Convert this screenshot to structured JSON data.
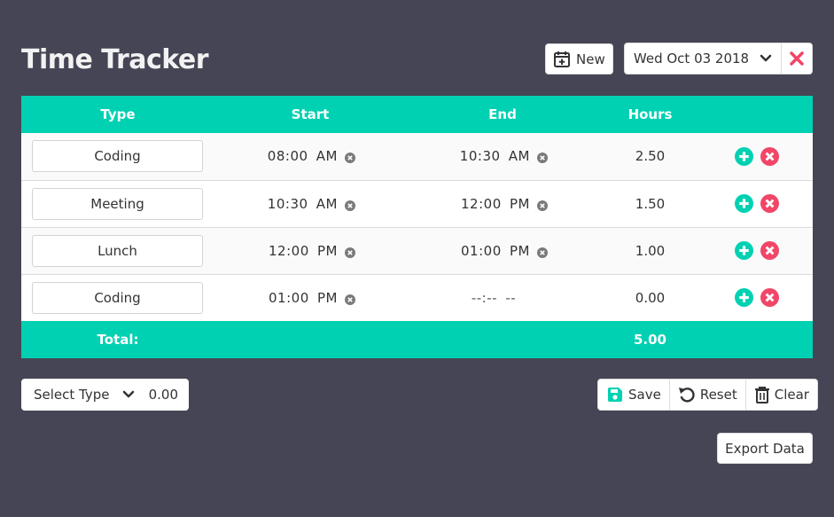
{
  "header": {
    "title": "Time Tracker",
    "new_label": "New",
    "date_value": "Wed Oct 03 2018"
  },
  "table": {
    "columns": [
      "Type",
      "Start",
      "End",
      "Hours"
    ],
    "rows": [
      {
        "type": "Coding",
        "start": "08:00 AM",
        "end": "10:30 AM",
        "hours": "2.50"
      },
      {
        "type": "Meeting",
        "start": "10:30 AM",
        "end": "12:00 PM",
        "hours": "1.50"
      },
      {
        "type": "Lunch",
        "start": "12:00 PM",
        "end": "01:00 PM",
        "hours": "1.00"
      },
      {
        "type": "Coding",
        "start": "01:00 PM",
        "end": "--:-- --",
        "hours": "0.00"
      }
    ],
    "total_label": "Total:",
    "total_value": "5.00"
  },
  "footer": {
    "select_type_label": "Select Type",
    "select_type_value": "0.00",
    "save_label": "Save",
    "reset_label": "Reset",
    "clear_label": "Clear",
    "export_label": "Export Data"
  },
  "colors": {
    "background": "#454555",
    "accent": "#00d1b2",
    "danger": "#f14668"
  },
  "icons": {
    "new": "calendar-plus-icon",
    "date_clear": "close-icon",
    "add_row": "plus-circle-icon",
    "remove_row": "times-circle-icon",
    "save": "floppy-icon",
    "reset": "undo-icon",
    "clear": "trash-icon"
  }
}
